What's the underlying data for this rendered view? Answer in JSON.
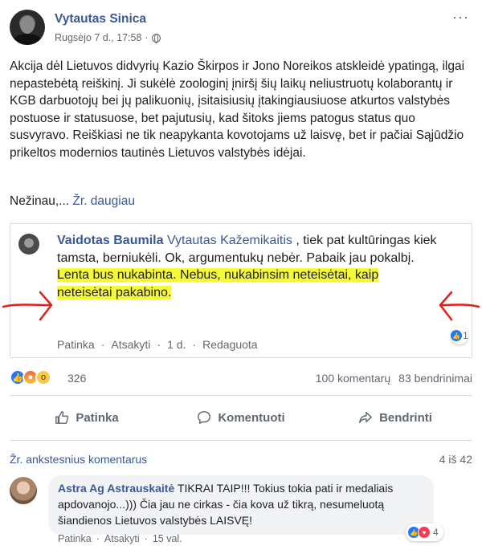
{
  "post": {
    "author": "Vytautas Sinica",
    "date": "Rugsėjo 7 d., 17:58",
    "date_separator": "·",
    "icons": {
      "privacy": "globe-icon",
      "more": "more-options-icon"
    },
    "more_glyph": "···",
    "body": "Akcija dėl Lietuvos didvyrių Kazio Škirpos ir Jono Noreikos atskleidė ypatingą, ilgai nepastebėtą reiškinį. Ji sukėlė zoologinį įniršį šių laikų neliustruotų kolaborantų ir KGB darbuotojų bei jų palikuonių, įsitaisiusių įtakingiausiuose atkurtos valstybės postuose ir statusuose, bet pajutusių, kad šitoks jiems patogus status quo susvyravo. Reiškiasi ne tik neapykanta kovotojams už laisvę, bet ir pačiai Sąjūdžio prikeltos modernios tautinės Lietuvos valstybės idėjai.",
    "truncated": "Nežinau,...",
    "see_more": "Žr. daugiau"
  },
  "embedded_comment": {
    "author": "Vaidotas Baumila",
    "tagged": "Vytautas Kažemikaitis",
    "text": " , tiek pat kultūringas kiek tamsta, berniukėli. Ok, argumentukų nebėr. Pabaik jau pokalbį.",
    "highlight_line1": "Lenta bus nukabinta. Nebus, nukabinsim neteisėtai, kaip",
    "highlight_line2": "neteisėtai pakabino.",
    "actions": [
      "Patinka",
      "·",
      "Atsakyti",
      "·",
      "1 d.",
      "·",
      "Redaguota"
    ],
    "reaction_count": "1",
    "annotation_color": "#e0221a",
    "highlight_color": "#f6f93a"
  },
  "reactions": {
    "icons": [
      "like-icon",
      "angry-icon",
      "wow-icon"
    ],
    "count": "326",
    "comments": "100 komentarų",
    "shares": "83 bendrinimai"
  },
  "actions": {
    "like": "Patinka",
    "comment": "Komentuoti",
    "share": "Bendrinti"
  },
  "comments": {
    "view_previous": "Žr. ankstesnius komentarus",
    "counter": "4 iš 42",
    "items": [
      {
        "author": "Astra Ag Astrauskaitė",
        "text": " TIKRAI TAIP!!! Tokius tokia pati ir medaliais apdovanojo...))) Čia jau ne cirkas - čia kova už tikrą, nesumeluotą šiandienos Lietuvos valstybės LAISVĘ!",
        "actions": [
          "Patinka",
          "·",
          "Atsakyti",
          "·",
          "15 val."
        ],
        "reaction_count": "4"
      }
    ]
  },
  "colors": {
    "link": "#385898",
    "secondary_text": "#616770",
    "like_blue": "#2078f4"
  }
}
